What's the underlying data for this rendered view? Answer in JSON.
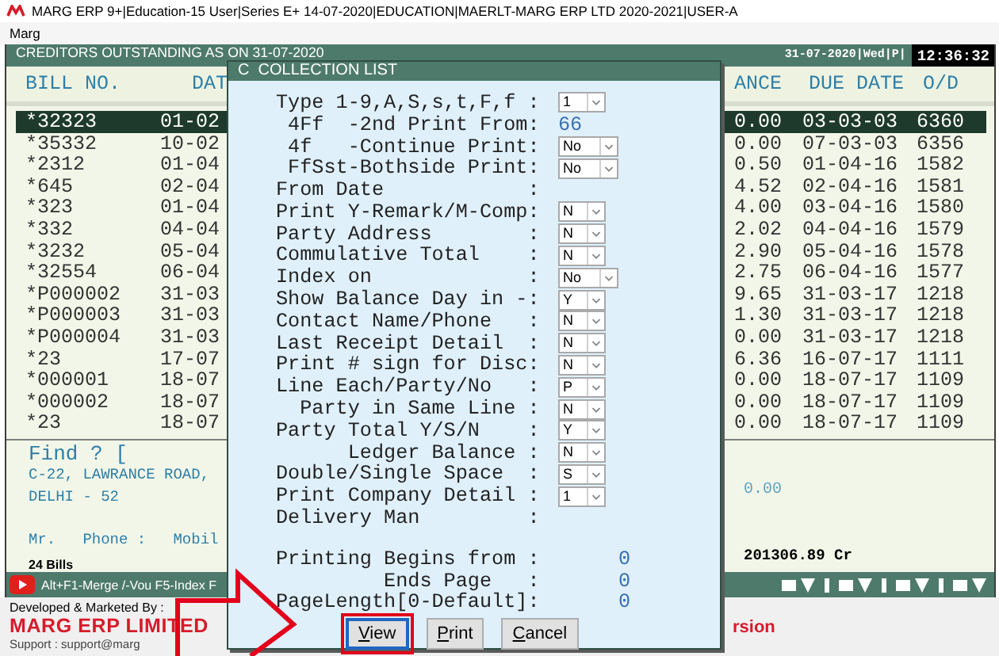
{
  "window": {
    "title": "MARG ERP 9+|Education-15 User|Series E+ 14-07-2020|EDUCATION|MAERLT-MARG ERP LTD 2020-2021|USER-A"
  },
  "menu": [
    "Marg"
  ],
  "report": {
    "title": "CREDITORS OUTSTANDING AS ON 31-07-2020",
    "date_info": "31-07-2020|Wed|P|",
    "clock": "12:36:32"
  },
  "table": {
    "columns": [
      "BILL NO.",
      "DAT",
      "ANCE",
      "DUE DATE",
      "O/D"
    ],
    "rows": [
      {
        "cells": [
          "*32323",
          "01-02",
          "0.00",
          "03-03-03",
          "6360"
        ],
        "selected": true
      },
      {
        "cells": [
          "*35332",
          "10-02",
          "0.00",
          "07-03-03",
          "6356"
        ],
        "selected": false
      },
      {
        "cells": [
          "*2312",
          "01-04",
          "0.50",
          "01-04-16",
          "1582"
        ],
        "selected": false
      },
      {
        "cells": [
          "*645",
          "02-04",
          "4.52",
          "02-04-16",
          "1581"
        ],
        "selected": false
      },
      {
        "cells": [
          "*323",
          "01-04",
          "4.00",
          "03-04-16",
          "1580"
        ],
        "selected": false
      },
      {
        "cells": [
          "*332",
          "04-04",
          "2.02",
          "04-04-16",
          "1579"
        ],
        "selected": false
      },
      {
        "cells": [
          "*3232",
          "05-04",
          "2.90",
          "05-04-16",
          "1578"
        ],
        "selected": false
      },
      {
        "cells": [
          "*32554",
          "06-04",
          "2.75",
          "06-04-16",
          "1577"
        ],
        "selected": false
      },
      {
        "cells": [
          "*P000002",
          "31-03",
          "9.65",
          "31-03-17",
          "1218"
        ],
        "selected": false
      },
      {
        "cells": [
          "*P000003",
          "31-03",
          "1.30",
          "31-03-17",
          "1218"
        ],
        "selected": false
      },
      {
        "cells": [
          "*P000004",
          "31-03",
          "0.00",
          "31-03-17",
          "1218"
        ],
        "selected": false
      },
      {
        "cells": [
          "*23",
          "17-07",
          "6.36",
          "16-07-17",
          "1111"
        ],
        "selected": false
      },
      {
        "cells": [
          "*000001",
          "18-07",
          "0.00",
          "18-07-17",
          "1109"
        ],
        "selected": false
      },
      {
        "cells": [
          "*000002",
          "18-07",
          "0.00",
          "18-07-17",
          "1109"
        ],
        "selected": false
      },
      {
        "cells": [
          "*23",
          "18-07",
          "0.00",
          "18-07-17",
          "1109"
        ],
        "selected": false
      }
    ]
  },
  "details": {
    "find": "Find ? [",
    "address": [
      "C-22, LAWRANCE ROAD,",
      "DELHI - 52"
    ],
    "contact": "Mr.   Phone :   Mobil",
    "bill_count": "24 Bills",
    "amount": "0.00",
    "balance": "201306.89 Cr"
  },
  "toolbar": {
    "hint": "Alt+F1-Merge /-Vou F5-Index F"
  },
  "footer": {
    "developer_label": "Developed & Marketed By :",
    "company": "MARG ERP LIMITED",
    "support": "Support : support@marg",
    "version_fragment": "rsion"
  },
  "dialog": {
    "title": "C  COLLECTION LIST",
    "fields": [
      {
        "kind": "select",
        "label": "Type 1-9,A,S,s,t,F,f :",
        "value": "1"
      },
      {
        "kind": "number",
        "label": " 4Ff  -2nd Print From:",
        "value": "66"
      },
      {
        "kind": "select",
        "label": " 4f   -Continue Print:",
        "value": "No"
      },
      {
        "kind": "select",
        "label": " FfSst-Bothside Print:",
        "value": "No"
      },
      {
        "kind": "blank",
        "label": "From Date            :"
      },
      {
        "kind": "select",
        "label": "Print Y-Remark/M-Comp:",
        "value": "N"
      },
      {
        "kind": "select",
        "label": "Party Address        :",
        "value": "N"
      },
      {
        "kind": "select",
        "label": "Commulative Total    :",
        "value": "N"
      },
      {
        "kind": "select",
        "label": "Index on             :",
        "value": "No"
      },
      {
        "kind": "select",
        "label": "Show Balance Day in -:",
        "value": "Y"
      },
      {
        "kind": "select",
        "label": "Contact Name/Phone   :",
        "value": "N"
      },
      {
        "kind": "select",
        "label": "Last Receipt Detail  :",
        "value": "N"
      },
      {
        "kind": "select",
        "label": "Print # sign for Disc:",
        "value": "N"
      },
      {
        "kind": "select",
        "label": "Line Each/Party/No   :",
        "value": "P"
      },
      {
        "kind": "select",
        "label": "  Party in Same Line :",
        "value": "N"
      },
      {
        "kind": "select",
        "label": "Party Total Y/S/N    :",
        "value": "Y"
      },
      {
        "kind": "select",
        "label": "      Ledger Balance :",
        "value": "N"
      },
      {
        "kind": "select",
        "label": "Double/Single Space  :",
        "value": "S"
      },
      {
        "kind": "select",
        "label": "Print Company Detail :",
        "value": "1"
      },
      {
        "kind": "blank",
        "label": "Delivery Man         :"
      }
    ],
    "page_fields": [
      {
        "label": "Printing Begins from :",
        "value": "0"
      },
      {
        "label": "         Ends Page   :",
        "value": "0"
      },
      {
        "label": "PageLength[0-Default]:",
        "value": "0"
      }
    ],
    "buttons": [
      {
        "label": "View",
        "highlighted": true
      },
      {
        "label": "Print",
        "highlighted": false
      },
      {
        "label": "Cancel",
        "highlighted": false
      }
    ]
  }
}
